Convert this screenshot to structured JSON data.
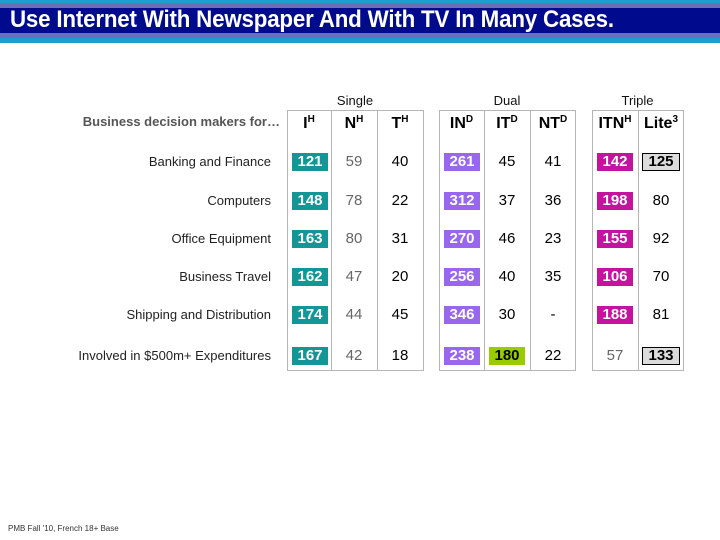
{
  "slide": {
    "title": "Use Internet With Newspaper And With TV In Many Cases.",
    "row_header": "Business decision makers for…",
    "footnote": "PMB Fall '10, French 18+ Base"
  },
  "groups": [
    {
      "label": "Single",
      "columns": [
        {
          "main": "I",
          "sup": "H"
        },
        {
          "main": "N",
          "sup": "H"
        },
        {
          "main": "T",
          "sup": "H"
        }
      ]
    },
    {
      "label": "Dual",
      "columns": [
        {
          "main": "IN",
          "sup": "D"
        },
        {
          "main": "IT",
          "sup": "D"
        },
        {
          "main": "NT",
          "sup": "D"
        }
      ]
    },
    {
      "label": "Triple",
      "columns": [
        {
          "main": "ITN",
          "sup": "H"
        },
        {
          "main": "Lite",
          "sup": "3"
        }
      ]
    }
  ],
  "highlight_colors": {
    "teal": "#139696",
    "violet": "#9966ee",
    "magenta": "#c4139e",
    "lime": "#99cc00",
    "boxed_gray": "#dcdcdc"
  },
  "rows": [
    {
      "label": "Banking and Finance",
      "values": [
        "121",
        "59",
        "40",
        "261",
        "45",
        "41",
        "142",
        "125"
      ],
      "styles": [
        "teal",
        "gray",
        "black",
        "violet",
        "black",
        "black",
        "magenta",
        "boxed"
      ]
    },
    {
      "label": "Computers",
      "values": [
        "148",
        "78",
        "22",
        "312",
        "37",
        "36",
        "198",
        "80"
      ],
      "styles": [
        "teal",
        "gray",
        "black",
        "violet",
        "black",
        "black",
        "magenta",
        "black"
      ]
    },
    {
      "label": "Office Equipment",
      "values": [
        "163",
        "80",
        "31",
        "270",
        "46",
        "23",
        "155",
        "92"
      ],
      "styles": [
        "teal",
        "gray",
        "black",
        "violet",
        "black",
        "black",
        "magenta",
        "black"
      ]
    },
    {
      "label": "Business Travel",
      "values": [
        "162",
        "47",
        "20",
        "256",
        "40",
        "35",
        "106",
        "70"
      ],
      "styles": [
        "teal",
        "gray",
        "black",
        "violet",
        "black",
        "black",
        "magenta",
        "black"
      ]
    },
    {
      "label": "Shipping and Distribution",
      "values": [
        "174",
        "44",
        "45",
        "346",
        "30",
        "-",
        "188",
        "81"
      ],
      "styles": [
        "teal",
        "gray",
        "black",
        "violet",
        "black",
        "black",
        "magenta",
        "black"
      ]
    },
    {
      "label": "Involved in $500m+ Expenditures",
      "values": [
        "167",
        "42",
        "18",
        "238",
        "180",
        "22",
        "57",
        "133"
      ],
      "styles": [
        "teal",
        "gray",
        "black",
        "violet",
        "lime",
        "black",
        "gray",
        "boxed"
      ]
    }
  ]
}
